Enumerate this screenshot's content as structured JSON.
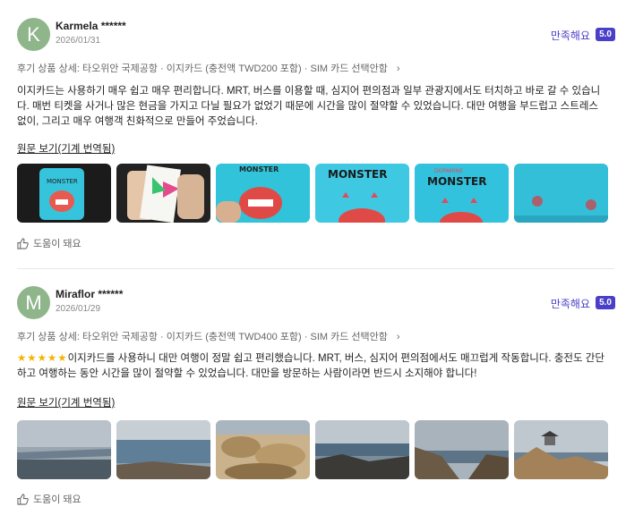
{
  "reviews": [
    {
      "avatar_letter": "K",
      "user": "Karmela ******",
      "date": "2026/01/31",
      "rating_text": "만족해요",
      "score": "5.0",
      "product": "후기 상품 상세: 타오위안 국제공항 · 이지카드 (충전액 TWD200 포함) · SIM 카드 선택안함",
      "text": "이지카드는 사용하기 매우 쉽고 매우 편리합니다. MRT, 버스를 이용할 때, 심지어 편의점과 일부 관광지에서도 터치하고 바로 갈 수 있습니다. 매번 티켓을 사거나 많은 현금을 가지고 다닐 필요가 없었기 때문에 시간을 많이 절약할 수 있었습니다. 대만 여행을 부드럽고 스트레스 없이, 그리고 매우 여행객 친화적으로 만들어 주었습니다.",
      "original_link": "원문 보기(기계 번역됨)",
      "helpful": "도움이 돼요"
    },
    {
      "avatar_letter": "M",
      "user": "Miraflor ******",
      "date": "2026/01/29",
      "rating_text": "만족해요",
      "score": "5.0",
      "product": "후기 상품 상세: 타오위안 국제공항 · 이지카드 (충전액 TWD400 포함) · SIM 카드 선택안함",
      "text": "이지카드를 사용하니 대만 여행이 정말 쉽고 편리했습니다. MRT, 버스, 심지어 편의점에서도 매끄럽게 작동합니다. 충전도 간단하고 여행하는 동안 시간을 많이 절약할 수 있었습니다. 대만을 방문하는 사람이라면 반드시 소지해야 합니다!",
      "stars": "★★★★★",
      "original_link": "원문 보기(기계 번역됨)",
      "helpful": "도움이 돼요"
    }
  ],
  "photo_names": [
    "monster-card-photo",
    "card-in-hand-photo",
    "monster-card-closeup-photo",
    "monster-title-photo",
    "dopamine-monster-photo",
    "blurred-card-photo"
  ],
  "photo_names_2": [
    "coast-photo-1",
    "coast-photo-2",
    "rock-formation-photo",
    "rocky-shore-photo",
    "sea-cliff-photo",
    "pavilion-cliff-photo"
  ]
}
